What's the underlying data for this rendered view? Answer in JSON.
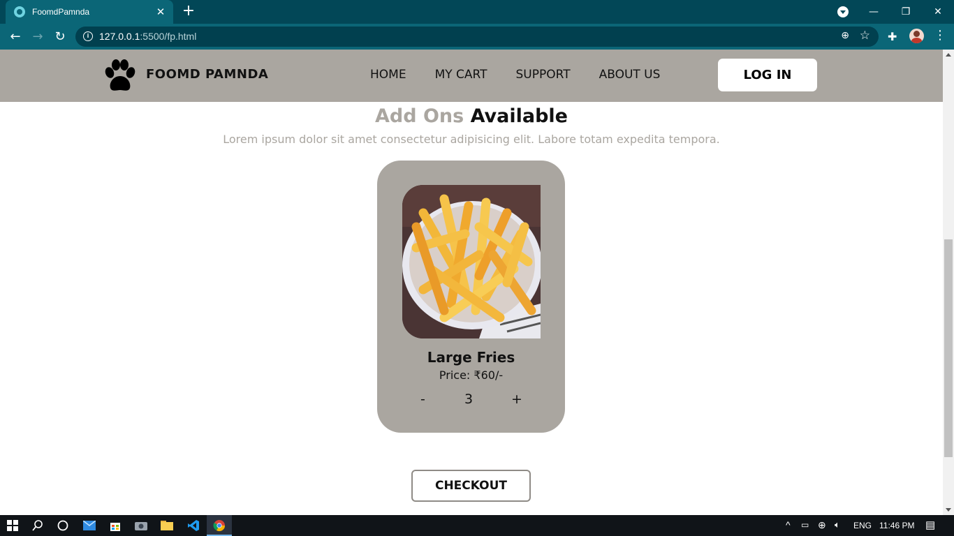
{
  "browser": {
    "tab_title": "FoomdPamnda",
    "tab_close": "✕",
    "new_tab": "+",
    "url_host": "127.0.0.1",
    "url_rest": ":5500/fp.html",
    "window_controls": {
      "minimize": "—",
      "restore": "❐",
      "close": "✕"
    }
  },
  "site": {
    "brand": "FOOMD PAMNDA",
    "nav": [
      "HOME",
      "MY CART",
      "SUPPORT",
      "ABOUT US"
    ],
    "login": "LOG IN"
  },
  "section": {
    "title_part1": "Add Ons",
    "title_part2": "Available",
    "subtitle": "Lorem ipsum dolor sit amet consectetur adipisicing elit. Labore totam expedita tempora."
  },
  "product": {
    "name": "Large Fries",
    "price": "Price: ₹60/-",
    "minus": "-",
    "quantity": "3",
    "plus": "+"
  },
  "checkout": "CHECKOUT",
  "taskbar": {
    "language": "ENG",
    "time": "11:46 PM"
  },
  "colors": {
    "accent": "#aaa6a0",
    "chrome_dark": "#024757",
    "chrome": "#0b6677"
  }
}
